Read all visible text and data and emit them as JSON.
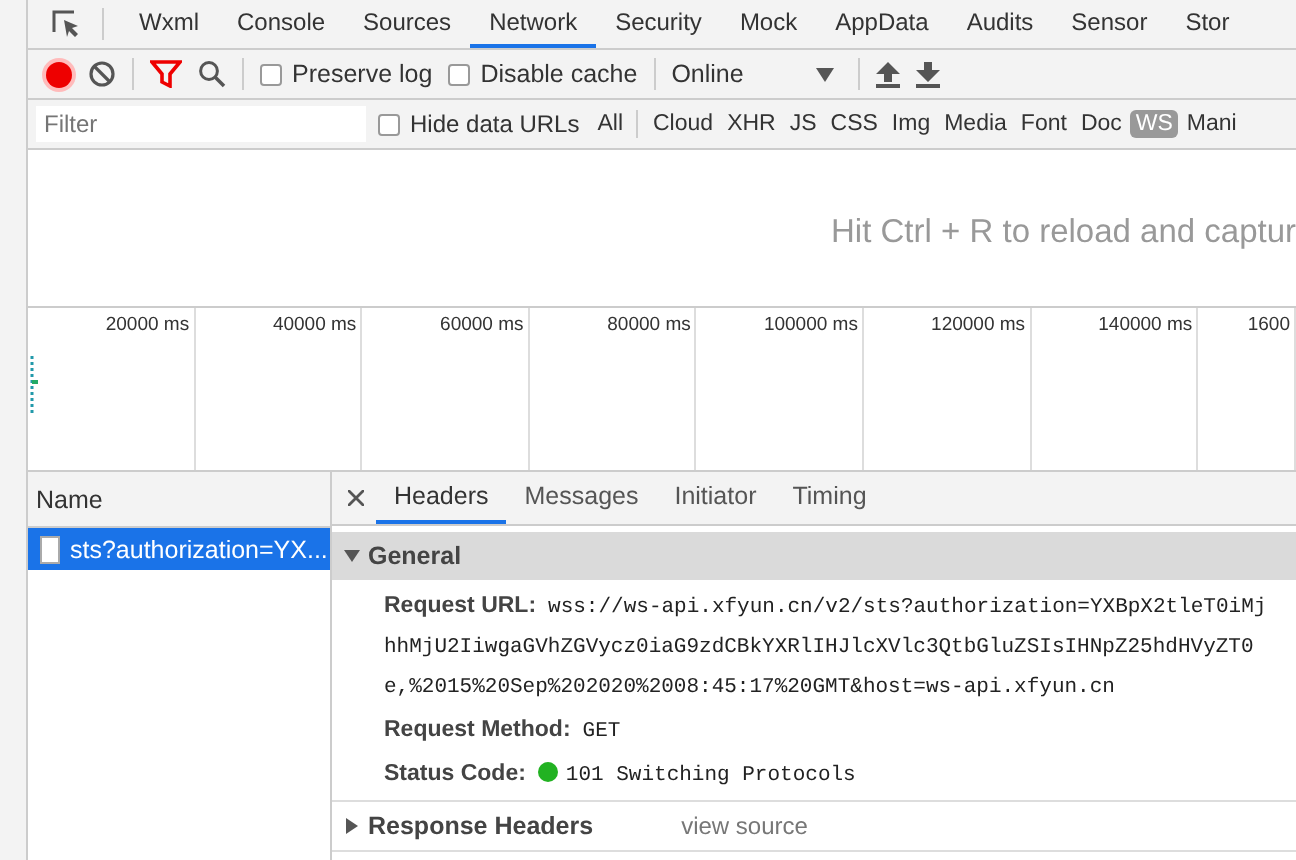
{
  "tabs": [
    {
      "label": "Wxml",
      "selected": false
    },
    {
      "label": "Console",
      "selected": false
    },
    {
      "label": "Sources",
      "selected": false
    },
    {
      "label": "Network",
      "selected": true
    },
    {
      "label": "Security",
      "selected": false
    },
    {
      "label": "Mock",
      "selected": false
    },
    {
      "label": "AppData",
      "selected": false
    },
    {
      "label": "Audits",
      "selected": false
    },
    {
      "label": "Sensor",
      "selected": false
    },
    {
      "label": "Stor",
      "selected": false
    }
  ],
  "toolbar": {
    "recording": true,
    "preserve_log": {
      "label": "Preserve log",
      "checked": false
    },
    "disable_cache": {
      "label": "Disable cache",
      "checked": false
    },
    "throttling": "Online"
  },
  "filter": {
    "placeholder": "Filter",
    "hide_data_urls": {
      "label": "Hide data URLs",
      "checked": false
    },
    "types": [
      {
        "label": "All",
        "selected": false
      },
      {
        "label": "Cloud",
        "selected": false
      },
      {
        "label": "XHR",
        "selected": false
      },
      {
        "label": "JS",
        "selected": false
      },
      {
        "label": "CSS",
        "selected": false
      },
      {
        "label": "Img",
        "selected": false
      },
      {
        "label": "Media",
        "selected": false
      },
      {
        "label": "Font",
        "selected": false
      },
      {
        "label": "Doc",
        "selected": false
      },
      {
        "label": "WS",
        "selected": true
      },
      {
        "label": "Mani",
        "selected": false
      }
    ]
  },
  "overview": {
    "message": "Hit Ctrl + R to reload and captur"
  },
  "timeline": {
    "ticks": [
      "20000 ms",
      "40000 ms",
      "60000 ms",
      "80000 ms",
      "100000 ms",
      "120000 ms",
      "140000 ms",
      "1600"
    ]
  },
  "requests": {
    "column": "Name",
    "rows": [
      {
        "name": "sts?authorization=YX...",
        "selected": true
      }
    ]
  },
  "detail": {
    "tabs": [
      {
        "label": "Headers",
        "selected": true
      },
      {
        "label": "Messages",
        "selected": false
      },
      {
        "label": "Initiator",
        "selected": false
      },
      {
        "label": "Timing",
        "selected": false
      }
    ],
    "sections": [
      {
        "title": "General",
        "expanded": true,
        "fields": [
          {
            "kind": "text",
            "label": "Request URL:",
            "value_lines": [
              "wss://ws-api.xfyun.cn/v2/sts?authorization=YXBpX2tleT0iMj",
              "hhMjU2IiwgaGVhZGVycz0iaG9zdCBkYXRlIHJlcXVlc3QtbGluZSIsIHNpZ25hdHVyZT0",
              "e,%2015%20Sep%202020%2008:45:17%20GMT&host=ws-api.xfyun.cn"
            ]
          },
          {
            "kind": "text",
            "label": "Request Method:",
            "value_lines": [
              "GET"
            ]
          },
          {
            "kind": "status",
            "label": "Status Code:",
            "value_lines": [
              "101 Switching Protocols"
            ]
          }
        ]
      },
      {
        "title": "Response Headers",
        "expanded": false,
        "link": "view source"
      }
    ]
  }
}
